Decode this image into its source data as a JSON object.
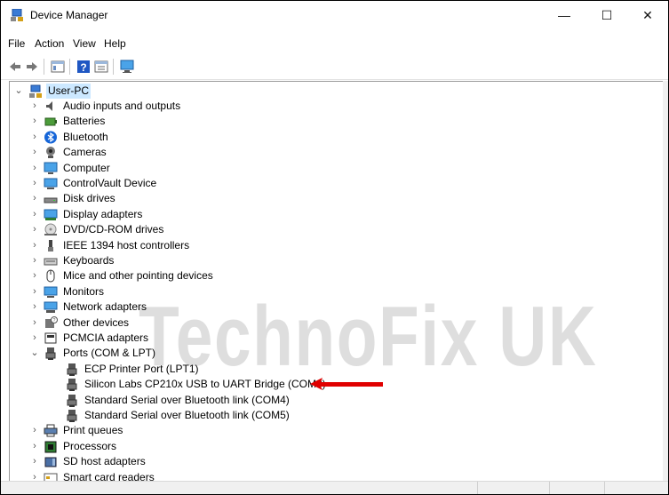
{
  "window": {
    "title": "Device Manager",
    "minimize": "—",
    "maximize": "☐",
    "close": "✕"
  },
  "menu": [
    "File",
    "Action",
    "View",
    "Help"
  ],
  "tree": {
    "root": "User-PC",
    "categories": [
      {
        "label": "Audio inputs and outputs",
        "icon": "speaker-icon"
      },
      {
        "label": "Batteries",
        "icon": "battery-icon"
      },
      {
        "label": "Bluetooth",
        "icon": "bluetooth-icon"
      },
      {
        "label": "Cameras",
        "icon": "camera-icon"
      },
      {
        "label": "Computer",
        "icon": "computer-icon"
      },
      {
        "label": "ControlVault Device",
        "icon": "monitor-icon"
      },
      {
        "label": "Disk drives",
        "icon": "disk-drive-icon"
      },
      {
        "label": "Display adapters",
        "icon": "display-adapter-icon"
      },
      {
        "label": "DVD/CD-ROM drives",
        "icon": "dvd-icon"
      },
      {
        "label": "IEEE 1394 host controllers",
        "icon": "firewire-icon"
      },
      {
        "label": "Keyboards",
        "icon": "keyboard-icon"
      },
      {
        "label": "Mice and other pointing devices",
        "icon": "mouse-icon"
      },
      {
        "label": "Monitors",
        "icon": "monitor-icon"
      },
      {
        "label": "Network adapters",
        "icon": "network-icon"
      },
      {
        "label": "Other devices",
        "icon": "unknown-device-icon"
      },
      {
        "label": "PCMCIA adapters",
        "icon": "pcmcia-icon"
      },
      {
        "label": "Ports (COM & LPT)",
        "icon": "port-icon",
        "expanded": true
      },
      {
        "label": "ECP Printer Port (LPT1)",
        "icon": "port-icon",
        "child": true
      },
      {
        "label": "Silicon Labs CP210x USB to UART Bridge (COM3)",
        "icon": "port-icon",
        "child": true
      },
      {
        "label": "Standard Serial over Bluetooth link (COM4)",
        "icon": "port-icon",
        "child": true
      },
      {
        "label": "Standard Serial over Bluetooth link (COM5)",
        "icon": "port-icon",
        "child": true
      },
      {
        "label": "Print queues",
        "icon": "printer-icon"
      },
      {
        "label": "Processors",
        "icon": "processor-icon"
      },
      {
        "label": "SD host adapters",
        "icon": "sd-icon"
      },
      {
        "label": "Smart card readers",
        "icon": "smart-card-icon"
      }
    ]
  },
  "watermark": "TechnoFix UK",
  "colors": {
    "arrow": "#e00000",
    "selection": "#cce8ff"
  }
}
